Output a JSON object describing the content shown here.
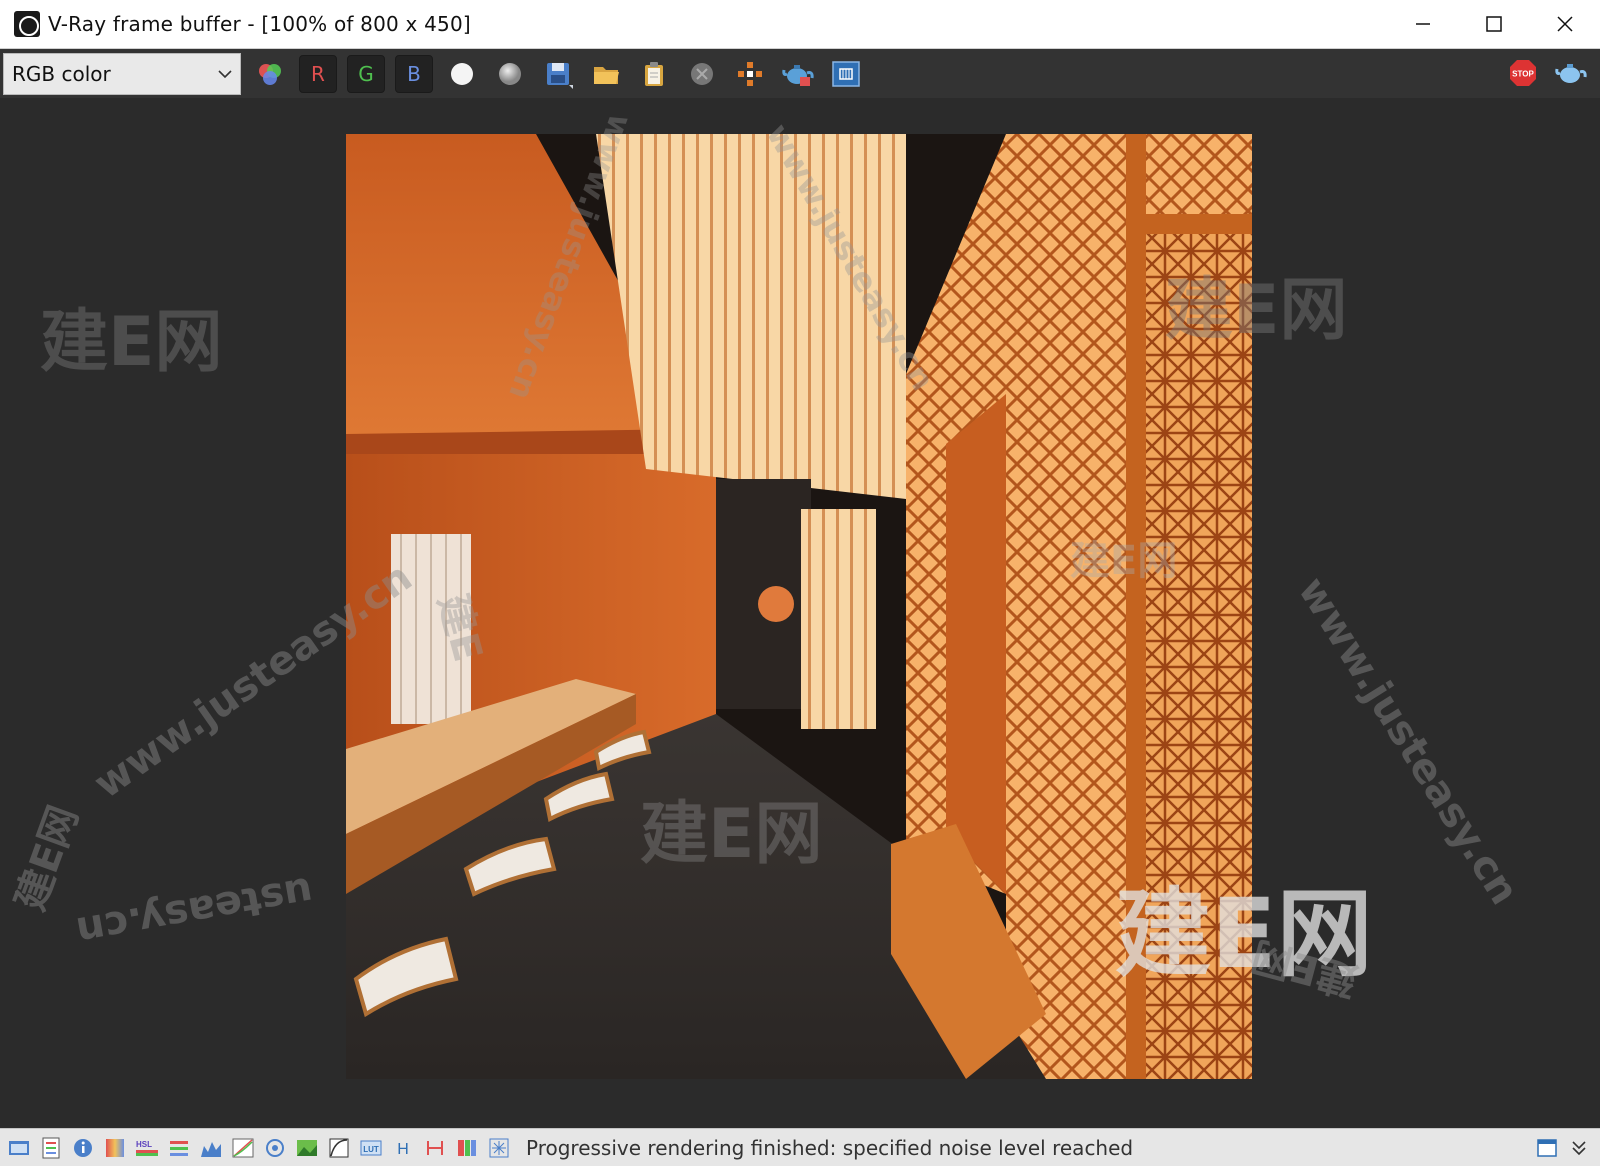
{
  "window": {
    "title": "V-Ray frame buffer - [100% of 800 x 450]"
  },
  "toolbar": {
    "channel_select_value": "RGB color",
    "channel_r": "R",
    "channel_g": "G",
    "channel_b": "B",
    "icons": [
      "channels-icon",
      "mono-white-icon",
      "mono-gray-icon",
      "save-icon",
      "open-icon",
      "clipboard-icon",
      "clear-icon",
      "track-mouse-icon",
      "render-teapot-icon",
      "region-icon",
      "stop-icon",
      "teapot-icon"
    ],
    "stop_label": "STOP"
  },
  "watermarks": {
    "site": "www.justeasy.cn",
    "site_short": "www.justeasy",
    "brand": "建E网",
    "brand_small": "建E",
    "site_cn": "cn",
    "site_tail": "usteasy.cn"
  },
  "statusbar": {
    "message": "Progressive rendering finished: specified noise level reached",
    "icon_labels": {
      "hsl": "HSL",
      "lut": "LUT",
      "h": "H"
    }
  },
  "colors": {
    "toolbar_bg": "#333333",
    "viewport_bg": "#2b2b2b",
    "statusbar_bg": "#e6e6e6",
    "channel_r": "#e05050",
    "channel_g": "#4fc04f",
    "channel_b": "#6a8fe0"
  }
}
